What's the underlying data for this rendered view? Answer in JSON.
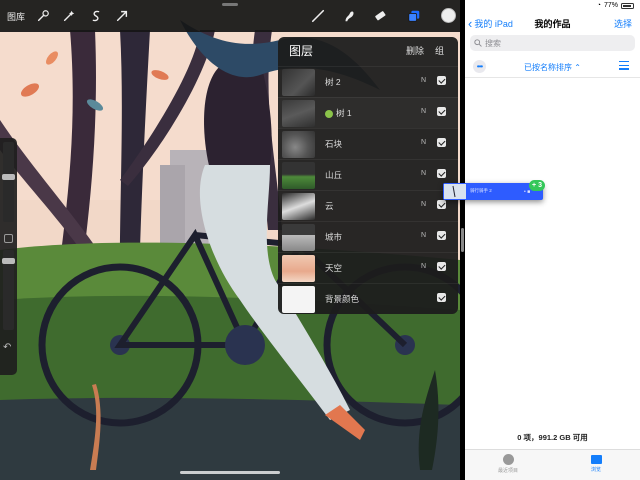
{
  "procreate": {
    "gallery_label": "图库",
    "toolbar_icons": [
      "wrench-icon",
      "magic-wand-icon",
      "selection-icon",
      "transform-arrow-icon",
      "brush-icon",
      "smudge-icon",
      "eraser-icon",
      "layers-icon"
    ],
    "layers_panel": {
      "title": "图层",
      "delete_label": "删除",
      "group_label": "组",
      "layers": [
        {
          "name": "树 2",
          "mode": "N",
          "visible": true
        },
        {
          "name": "树 1",
          "mode": "N",
          "visible": true,
          "icon": "leaf-icon"
        },
        {
          "name": "石块",
          "mode": "N",
          "visible": true
        },
        {
          "name": "山丘",
          "mode": "N",
          "visible": true
        },
        {
          "name": "云",
          "mode": "N",
          "visible": true
        },
        {
          "name": "城市",
          "mode": "N",
          "visible": true
        },
        {
          "name": "天空",
          "mode": "N",
          "visible": true
        },
        {
          "name": "背景颜色",
          "mode": "",
          "visible": true
        }
      ]
    },
    "colors": {
      "toolbar": "#1a1a1a",
      "active_tool": "#1e6cff",
      "panel": "#1c1c1c"
    }
  },
  "files": {
    "status_battery": "77%",
    "back_label": "我的 iPad",
    "title": "我的作品",
    "select_label": "选择",
    "search_placeholder": "搜索",
    "sort_label": "已按名称排序",
    "storage_text": "0 项，991.2 GB 可用",
    "tabs": [
      {
        "label": "最近项目",
        "active": false
      },
      {
        "label": "浏览",
        "active": true
      }
    ],
    "accent": "#147efb"
  },
  "drag": {
    "label": "骑行骑手 2",
    "badge_count": "3"
  }
}
